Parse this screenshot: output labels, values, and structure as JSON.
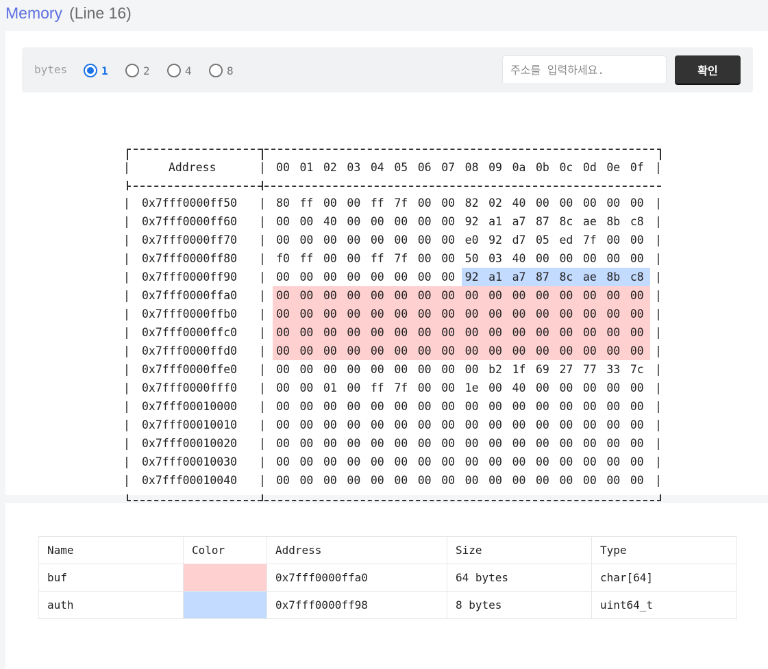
{
  "header": {
    "title": "Memory",
    "subtitle": "(Line 16)"
  },
  "toolbar": {
    "bytes_label": "bytes",
    "options": [
      "1",
      "2",
      "4",
      "8"
    ],
    "selected": "1",
    "address_placeholder": "주소를 입력하세요.",
    "address_value": "",
    "confirm_label": "확인"
  },
  "memory": {
    "address_header": "Address",
    "column_headers": [
      "00",
      "01",
      "02",
      "03",
      "04",
      "05",
      "06",
      "07",
      "08",
      "09",
      "0a",
      "0b",
      "0c",
      "0d",
      "0e",
      "0f"
    ],
    "rows": [
      {
        "address": "0x7fff0000ff50",
        "bytes": [
          "80",
          "ff",
          "00",
          "00",
          "ff",
          "7f",
          "00",
          "00",
          "82",
          "02",
          "40",
          "00",
          "00",
          "00",
          "00",
          "00"
        ]
      },
      {
        "address": "0x7fff0000ff60",
        "bytes": [
          "00",
          "00",
          "40",
          "00",
          "00",
          "00",
          "00",
          "00",
          "92",
          "a1",
          "a7",
          "87",
          "8c",
          "ae",
          "8b",
          "c8"
        ]
      },
      {
        "address": "0x7fff0000ff70",
        "bytes": [
          "00",
          "00",
          "00",
          "00",
          "00",
          "00",
          "00",
          "00",
          "e0",
          "92",
          "d7",
          "05",
          "ed",
          "7f",
          "00",
          "00"
        ]
      },
      {
        "address": "0x7fff0000ff80",
        "bytes": [
          "f0",
          "ff",
          "00",
          "00",
          "ff",
          "7f",
          "00",
          "00",
          "50",
          "03",
          "40",
          "00",
          "00",
          "00",
          "00",
          "00"
        ]
      },
      {
        "address": "0x7fff0000ff90",
        "bytes": [
          "00",
          "00",
          "00",
          "00",
          "00",
          "00",
          "00",
          "00",
          "92",
          "a1",
          "a7",
          "87",
          "8c",
          "ae",
          "8b",
          "c8"
        ]
      },
      {
        "address": "0x7fff0000ffa0",
        "bytes": [
          "00",
          "00",
          "00",
          "00",
          "00",
          "00",
          "00",
          "00",
          "00",
          "00",
          "00",
          "00",
          "00",
          "00",
          "00",
          "00"
        ]
      },
      {
        "address": "0x7fff0000ffb0",
        "bytes": [
          "00",
          "00",
          "00",
          "00",
          "00",
          "00",
          "00",
          "00",
          "00",
          "00",
          "00",
          "00",
          "00",
          "00",
          "00",
          "00"
        ]
      },
      {
        "address": "0x7fff0000ffc0",
        "bytes": [
          "00",
          "00",
          "00",
          "00",
          "00",
          "00",
          "00",
          "00",
          "00",
          "00",
          "00",
          "00",
          "00",
          "00",
          "00",
          "00"
        ]
      },
      {
        "address": "0x7fff0000ffd0",
        "bytes": [
          "00",
          "00",
          "00",
          "00",
          "00",
          "00",
          "00",
          "00",
          "00",
          "00",
          "00",
          "00",
          "00",
          "00",
          "00",
          "00"
        ]
      },
      {
        "address": "0x7fff0000ffe0",
        "bytes": [
          "00",
          "00",
          "00",
          "00",
          "00",
          "00",
          "00",
          "00",
          "00",
          "b2",
          "1f",
          "69",
          "27",
          "77",
          "33",
          "7c"
        ]
      },
      {
        "address": "0x7fff0000fff0",
        "bytes": [
          "00",
          "00",
          "01",
          "00",
          "ff",
          "7f",
          "00",
          "00",
          "1e",
          "00",
          "40",
          "00",
          "00",
          "00",
          "00",
          "00"
        ]
      },
      {
        "address": "0x7fff00010000",
        "bytes": [
          "00",
          "00",
          "00",
          "00",
          "00",
          "00",
          "00",
          "00",
          "00",
          "00",
          "00",
          "00",
          "00",
          "00",
          "00",
          "00"
        ]
      },
      {
        "address": "0x7fff00010010",
        "bytes": [
          "00",
          "00",
          "00",
          "00",
          "00",
          "00",
          "00",
          "00",
          "00",
          "00",
          "00",
          "00",
          "00",
          "00",
          "00",
          "00"
        ]
      },
      {
        "address": "0x7fff00010020",
        "bytes": [
          "00",
          "00",
          "00",
          "00",
          "00",
          "00",
          "00",
          "00",
          "00",
          "00",
          "00",
          "00",
          "00",
          "00",
          "00",
          "00"
        ]
      },
      {
        "address": "0x7fff00010030",
        "bytes": [
          "00",
          "00",
          "00",
          "00",
          "00",
          "00",
          "00",
          "00",
          "00",
          "00",
          "00",
          "00",
          "00",
          "00",
          "00",
          "00"
        ]
      },
      {
        "address": "0x7fff00010040",
        "bytes": [
          "00",
          "00",
          "00",
          "00",
          "00",
          "00",
          "00",
          "00",
          "00",
          "00",
          "00",
          "00",
          "00",
          "00",
          "00",
          "00"
        ]
      }
    ]
  },
  "variables": {
    "headers": [
      "Name",
      "Color",
      "Address",
      "Size",
      "Type"
    ],
    "rows": [
      {
        "name": "buf",
        "color": "#ffd0d0",
        "address": "0x7fff0000ffa0",
        "size": "64 bytes",
        "type": "char[64]",
        "size_bytes": 64
      },
      {
        "name": "auth",
        "color": "#c3dbff",
        "address": "0x7fff0000ff98",
        "size": "8 bytes",
        "type": "uint64_t",
        "size_bytes": 8
      }
    ]
  }
}
